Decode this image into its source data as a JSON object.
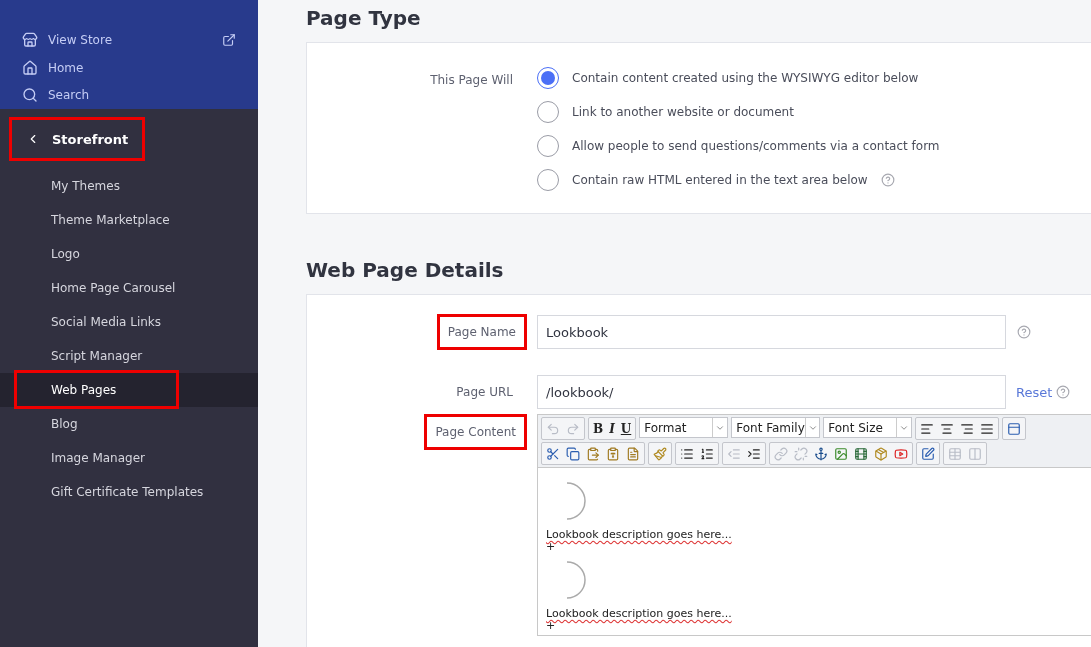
{
  "sidebar": {
    "top_items": [
      {
        "label": "View Store",
        "external": true
      },
      {
        "label": "Home",
        "external": false
      },
      {
        "label": "Search",
        "external": false
      }
    ],
    "section": {
      "label": "Storefront",
      "highlighted": true
    },
    "items": [
      {
        "label": "My Themes",
        "selected": false,
        "highlighted": false
      },
      {
        "label": "Theme Marketplace",
        "selected": false,
        "highlighted": false
      },
      {
        "label": "Logo",
        "selected": false,
        "highlighted": false
      },
      {
        "label": "Home Page Carousel",
        "selected": false,
        "highlighted": false
      },
      {
        "label": "Social Media Links",
        "selected": false,
        "highlighted": false
      },
      {
        "label": "Script Manager",
        "selected": false,
        "highlighted": false
      },
      {
        "label": "Web Pages",
        "selected": true,
        "highlighted": true
      },
      {
        "label": "Blog",
        "selected": false,
        "highlighted": false
      },
      {
        "label": "Image Manager",
        "selected": false,
        "highlighted": false
      },
      {
        "label": "Gift Certificate Templates",
        "selected": false,
        "highlighted": false
      }
    ]
  },
  "page_type": {
    "title": "Page Type",
    "label": "This Page Will",
    "options": [
      {
        "label": "Contain content created using the WYSIWYG editor below",
        "selected": true,
        "help": false
      },
      {
        "label": "Link to another website or document",
        "selected": false,
        "help": false
      },
      {
        "label": "Allow people to send questions/comments via a contact form",
        "selected": false,
        "help": false
      },
      {
        "label": "Contain raw HTML entered in the text area below",
        "selected": false,
        "help": true
      }
    ]
  },
  "details": {
    "title": "Web Page Details",
    "page_name": {
      "label": "Page Name",
      "value": "Lookbook",
      "highlighted": true
    },
    "page_url": {
      "label": "Page URL",
      "value": "/lookbook/",
      "reset": "Reset",
      "highlighted": false
    },
    "page_content": {
      "label": "Page Content",
      "highlighted": true,
      "format_buttons": [
        "B",
        "I",
        "U"
      ],
      "dropdowns": [
        "Format",
        "Font Family",
        "Font Size"
      ],
      "blocks": [
        {
          "text": "Lookbook description goes here...",
          "mark": "+"
        },
        {
          "text": "Lookbook description goes here...",
          "mark": "+"
        }
      ]
    }
  }
}
